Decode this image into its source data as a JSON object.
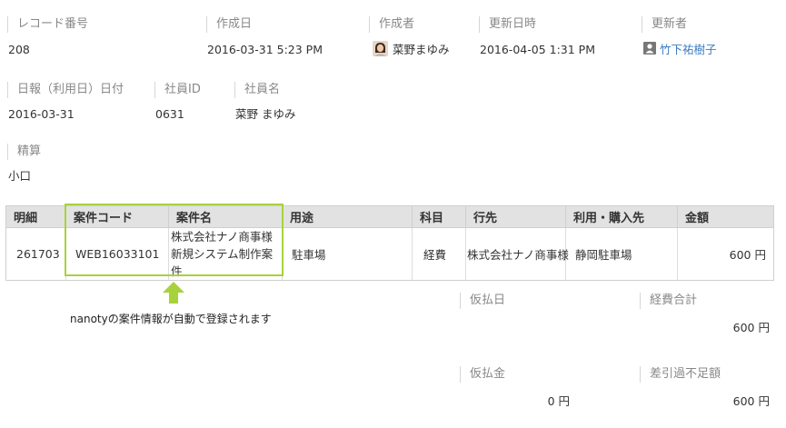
{
  "record": {
    "record_number": {
      "label": "レコード番号",
      "value": "208"
    },
    "created_at": {
      "label": "作成日",
      "value": "2016-03-31 5:23 PM"
    },
    "creator": {
      "label": "作成者",
      "value": "菜野まゆみ"
    },
    "updated_at": {
      "label": "更新日時",
      "value": "2016-04-05 1:31 PM"
    },
    "updater": {
      "label": "更新者",
      "value": "竹下祐樹子"
    }
  },
  "report": {
    "date": {
      "label": "日報（利用日）日付",
      "value": "2016-03-31"
    },
    "employee_id": {
      "label": "社員ID",
      "value": "0631"
    },
    "employee_name": {
      "label": "社員名",
      "value": "菜野 まゆみ"
    }
  },
  "settlement": {
    "label": "精算",
    "value": "小口"
  },
  "table": {
    "headers": [
      "明細",
      "案件コード",
      "案件名",
      "用途",
      "科目",
      "行先",
      "利用・購入先",
      "金額"
    ],
    "rows": [
      {
        "detail": "261703",
        "project_code": "WEB16033101",
        "project_name_line1": "株式会社ナノ商事様",
        "project_name_line2": "新規システム制作案件",
        "purpose": "駐車場",
        "account": "経費",
        "destination": "株式会社ナノ商事様",
        "vendor": "静岡駐車場",
        "amount": "600 円"
      }
    ]
  },
  "annotation": {
    "note": "nanotyの案件情報が自動で登録されます"
  },
  "summary": {
    "advance_date": {
      "label": "仮払日",
      "value": ""
    },
    "expense_total": {
      "label": "経費合計",
      "value": "600 円"
    },
    "advance_amount": {
      "label": "仮払金",
      "value": "0 円"
    },
    "balance_shortage": {
      "label": "差引過不足額",
      "value": "600 円"
    }
  },
  "colors": {
    "highlight": "#a8d23c",
    "link": "#3b7cc4",
    "header_bg": "#e2e2e2"
  },
  "icons": {
    "creator_avatar": "avatar-photo",
    "updater_icon": "user-icon",
    "arrow": "up-arrow-icon"
  }
}
